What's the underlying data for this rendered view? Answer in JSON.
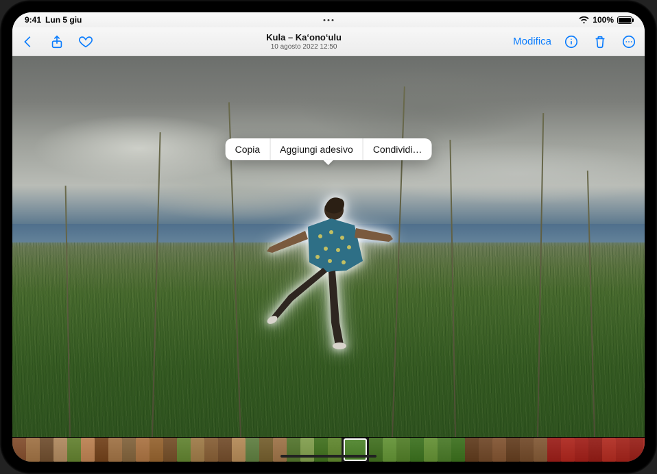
{
  "status": {
    "time": "9:41",
    "date": "Lun 5 giu",
    "battery_pct": "100%"
  },
  "nav": {
    "title": "Kula – Ka‘ono‘ulu",
    "subtitle": "10 agosto 2022 12:50",
    "edit_label": "Modifica"
  },
  "context_menu": {
    "copy": "Copia",
    "add_sticker": "Aggiungi adesivo",
    "share": "Condividi…"
  },
  "colors": {
    "accent": "#0a7cfd"
  },
  "thumbnails": [
    "#8b5a3c",
    "#a67c52",
    "#7a5b3e",
    "#b5916a",
    "#6e8a3f",
    "#c08a5e",
    "#7c4f2b",
    "#a67c52",
    "#8a6e4a",
    "#b07d50",
    "#9c6e3e",
    "#7e5b38",
    "#6d8c40",
    "#a58455",
    "#8f6a44",
    "#7d5a3b",
    "#b99263",
    "#6a874e",
    "#7e6a3d",
    "#a47d55",
    "#5f7e3c",
    "#8aa55a",
    "#4e7a2e",
    "#6b8f3d",
    "#5a8c3a",
    "#4f7a30",
    "#6e9a44",
    "#5e8738",
    "#4a7b2f",
    "#6f9843",
    "#578338",
    "#4a7a2e",
    "#6c4a2e",
    "#7a5538",
    "#8a6040",
    "#6f4c30",
    "#7c5739",
    "#8b6544",
    "#a22f2a",
    "#b3362e",
    "#a8302a",
    "#9b2d27",
    "#b63b31",
    "#aa342c",
    "#9f3029",
    "#b23930"
  ],
  "selected_thumb_index": 24
}
